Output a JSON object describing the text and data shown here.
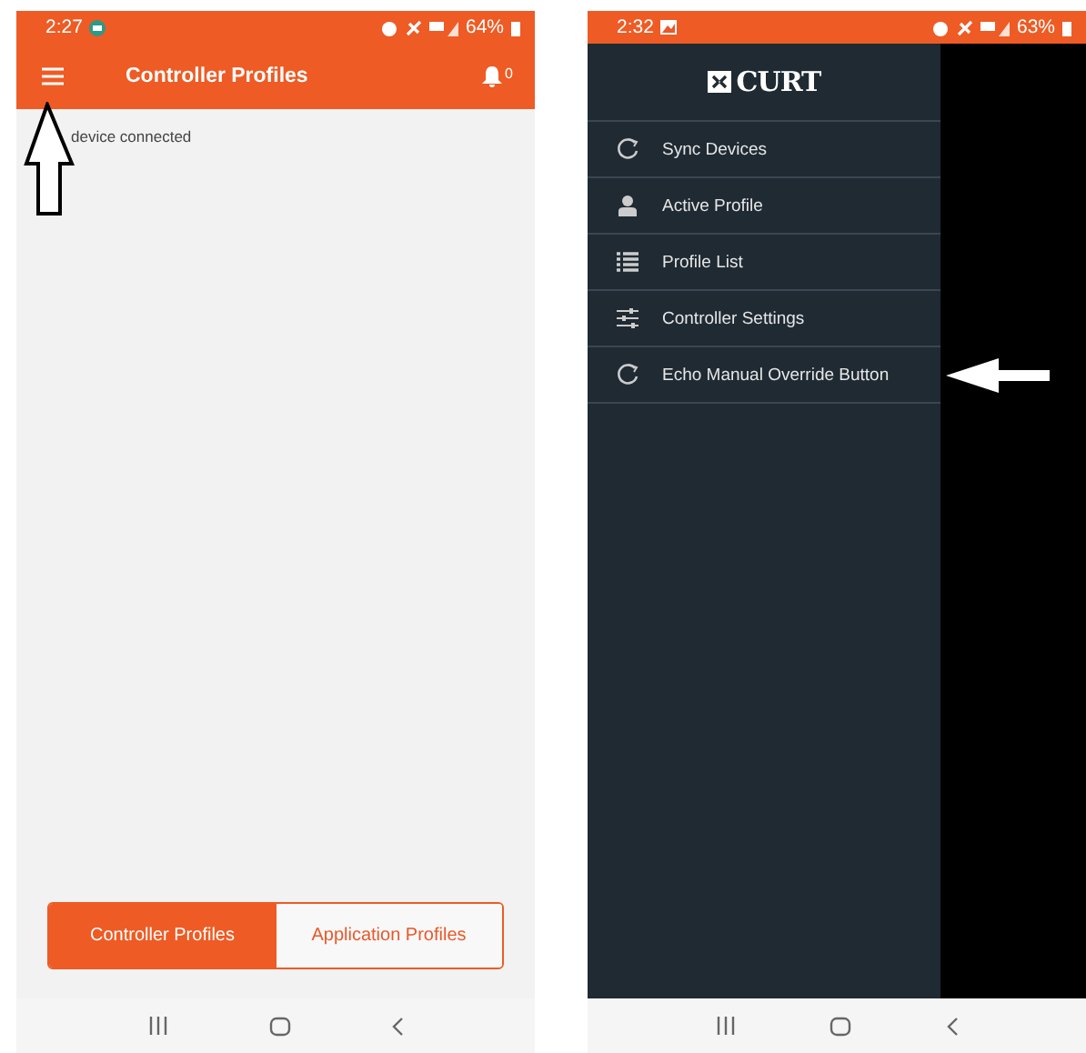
{
  "left_screen": {
    "status_bar": {
      "time": "2:27",
      "battery": "64%"
    },
    "app_bar": {
      "title": "Controller Profiles",
      "notification_count": "0"
    },
    "message": "device connected",
    "segments": [
      {
        "label": "Controller Profiles",
        "selected": true
      },
      {
        "label": "Application Profiles",
        "selected": false
      }
    ]
  },
  "right_screen": {
    "status_bar": {
      "time": "2:32",
      "battery": "63%"
    },
    "drawer": {
      "logo": "CURT",
      "items": [
        {
          "label": "Sync Devices",
          "kind": "sync"
        },
        {
          "label": "Active Profile",
          "kind": "person"
        },
        {
          "label": "Profile List",
          "kind": "list"
        },
        {
          "label": "Controller Settings",
          "kind": "sliders"
        },
        {
          "label": "Echo Manual Override Button",
          "kind": "sync"
        }
      ]
    }
  }
}
